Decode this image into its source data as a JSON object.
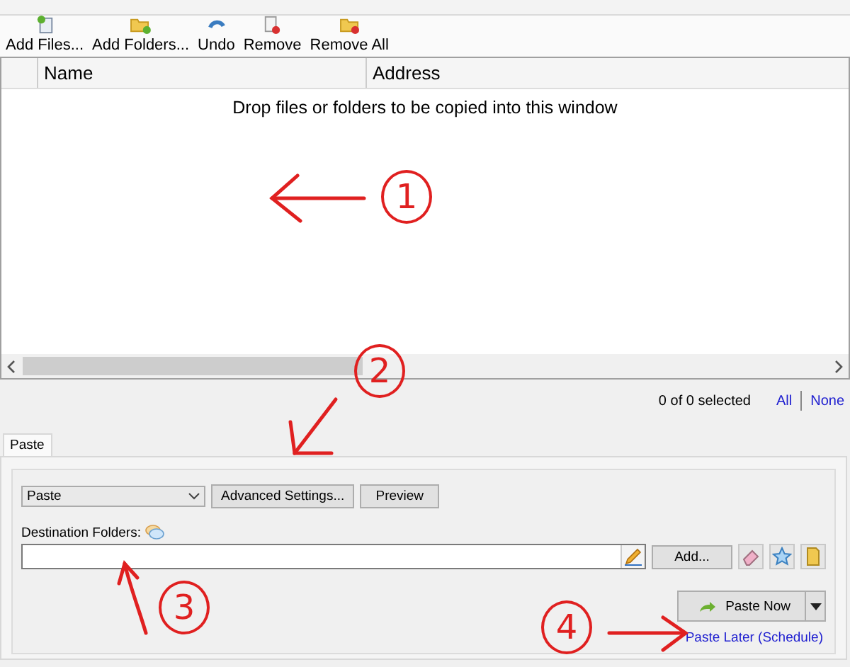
{
  "toolbar": [
    {
      "label": "Add Files..."
    },
    {
      "label": "Add Folders..."
    },
    {
      "label": "Undo"
    },
    {
      "label": "Remove"
    },
    {
      "label": "Remove All"
    }
  ],
  "file_list": {
    "columns": [
      "Name",
      "Address"
    ],
    "empty_message": "Drop files or folders to be copied into this window"
  },
  "selection": {
    "count": "0 of 0 selected",
    "links": [
      "All",
      "None"
    ]
  },
  "tabs": [
    {
      "label": "Paste",
      "selected": true
    }
  ],
  "paste_panel": {
    "mode": "Paste",
    "buttons": [
      "Advanced Settings...",
      "Preview"
    ],
    "destination_label": "Destination Folders:",
    "add_button": "Add...",
    "paste_button": "Paste Now",
    "schedule_link": "Paste Later (Schedule)"
  },
  "annotations": [
    {
      "label": "1"
    },
    {
      "label": "2"
    },
    {
      "label": "3"
    },
    {
      "label": "4"
    }
  ]
}
